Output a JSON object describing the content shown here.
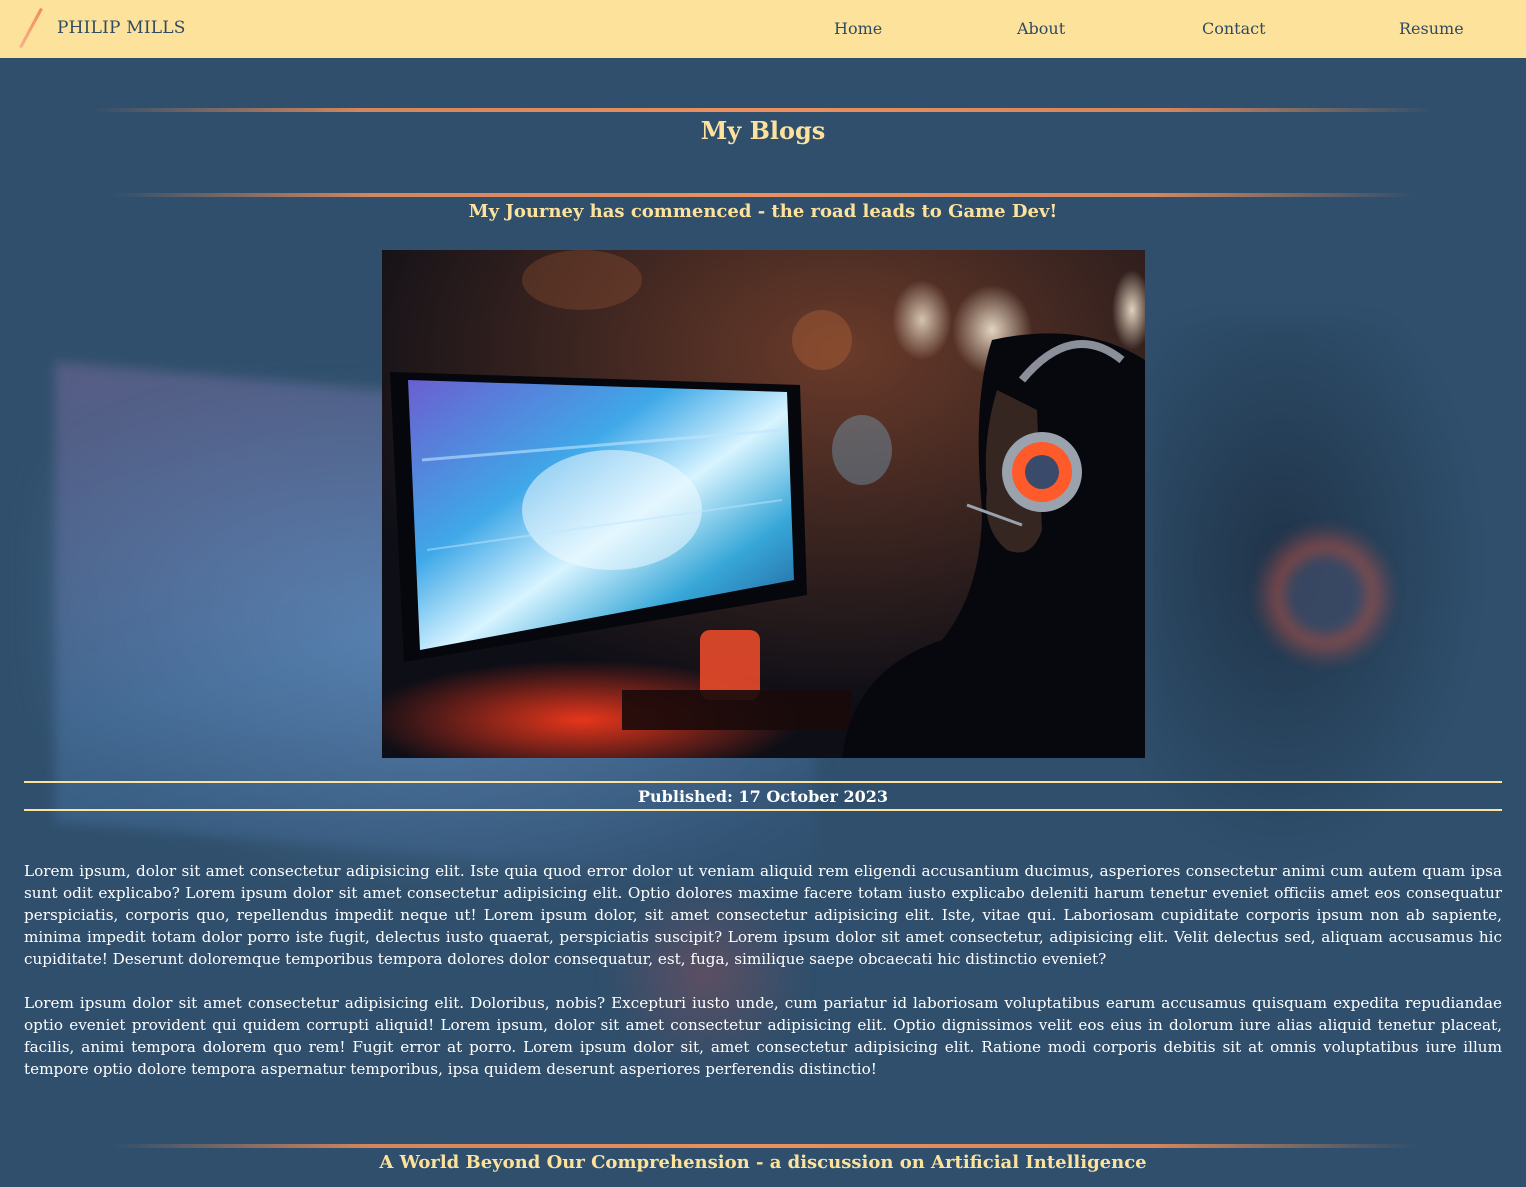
{
  "navbar": {
    "brand": "PHILIP MILLS",
    "links": [
      "Home",
      "About",
      "Contact",
      "Resume"
    ]
  },
  "page": {
    "title": "My Blogs"
  },
  "posts": [
    {
      "title": "My Journey has commenced - the road leads to Game Dev!",
      "published": "Published: 17 October 2023",
      "paragraphs": [
        "Lorem ipsum, dolor sit amet consectetur adipisicing elit. Iste quia quod error dolor ut veniam aliquid rem eligendi accusantium ducimus, asperiores consectetur animi cum autem quam ipsa sunt odit explicabo? Lorem ipsum dolor sit amet consectetur adipisicing elit. Optio dolores maxime facere totam iusto explicabo deleniti harum tenetur eveniet officiis amet eos consequatur perspiciatis, corporis quo, repellendus impedit neque ut! Lorem ipsum dolor, sit amet consectetur adipisicing elit. Iste, vitae qui. Laboriosam cupiditate corporis ipsum non ab sapiente, minima impedit totam dolor porro iste fugit, delectus iusto quaerat, perspiciatis suscipit? Lorem ipsum dolor sit amet consectetur, adipisicing elit. Velit delectus sed, aliquam accusamus hic cupiditate! Deserunt doloremque temporibus tempora dolores dolor consequatur, est, fuga, similique saepe obcaecati hic distinctio eveniet?",
        "Lorem ipsum dolor sit amet consectetur adipisicing elit. Doloribus, nobis? Excepturi iusto unde, cum pariatur id laboriosam voluptatibus earum accusamus quisquam expedita repudiandae optio eveniet provident qui quidem corrupti aliquid! Lorem ipsum, dolor sit amet consectetur adipisicing elit. Optio dignissimos velit eos eius in dolorum iure alias aliquid tenetur placeat, facilis, animi tempora dolorem quo rem! Fugit error at porro. Lorem ipsum dolor sit, amet consectetur adipisicing elit. Ratione modi corporis debitis sit at omnis voluptatibus iure illum tempore optio dolore tempora aspernatur temporibus, ipsa quidem deserunt asperiores perferendis distinctio!"
      ]
    },
    {
      "title": "A World Beyond Our Comprehension - a discussion on Artificial Intelligence"
    }
  ],
  "colors": {
    "navbar_bg": "#fde29c",
    "page_bg": "#2f4f6c",
    "accent_text": "#fde29c",
    "divider": "#eb915f"
  },
  "icons": {
    "brand": "pencil-slash-icon"
  }
}
